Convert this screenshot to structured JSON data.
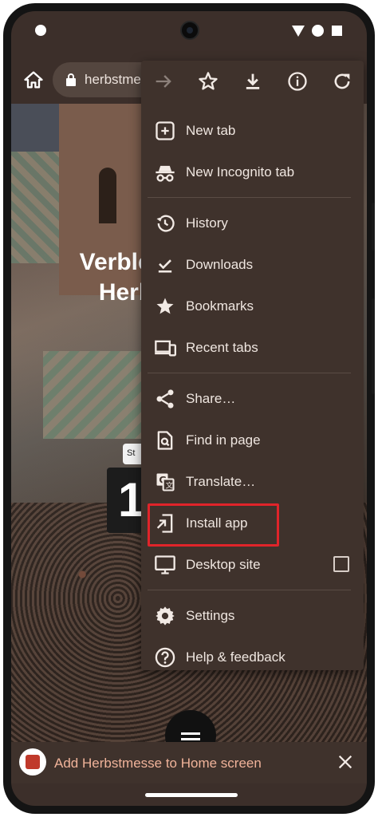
{
  "toolbar": {
    "url_text": "herbstmesse",
    "icons": [
      "home-icon",
      "lock-icon"
    ]
  },
  "page": {
    "headline_line1": "Verbleib",
    "headline_line2": "Herb",
    "counter_tab": "St",
    "counter_digit": "1"
  },
  "menu": {
    "actions": [
      "forward-icon",
      "star-icon",
      "download-icon",
      "info-icon",
      "refresh-icon"
    ],
    "items": [
      {
        "label": "New tab",
        "icon": "new-tab-icon"
      },
      {
        "label": "New Incognito tab",
        "icon": "incognito-icon"
      },
      {
        "label": "History",
        "icon": "history-icon"
      },
      {
        "label": "Downloads",
        "icon": "downloads-icon"
      },
      {
        "label": "Bookmarks",
        "icon": "star-icon"
      },
      {
        "label": "Recent tabs",
        "icon": "devices-icon"
      },
      {
        "label": "Share…",
        "icon": "share-icon"
      },
      {
        "label": "Find in page",
        "icon": "find-icon"
      },
      {
        "label": "Translate…",
        "icon": "translate-icon"
      },
      {
        "label": "Install app",
        "icon": "install-app-icon"
      },
      {
        "label": "Desktop site",
        "icon": "desktop-icon",
        "checked": false
      },
      {
        "label": "Settings",
        "icon": "gear-icon"
      },
      {
        "label": "Help & feedback",
        "icon": "help-icon"
      }
    ]
  },
  "install_bar": {
    "text": "Add Herbstmesse to Home screen"
  },
  "colors": {
    "menu_bg": "#3f322c",
    "highlight": "#e0242a",
    "install_text": "#f0b39a"
  }
}
